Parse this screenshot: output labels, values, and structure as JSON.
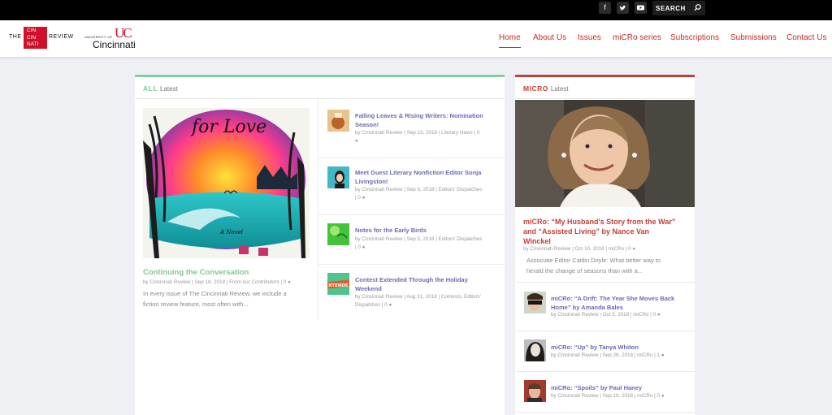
{
  "topbar": {
    "social": [
      "facebook-icon",
      "twitter-icon",
      "youtube-icon"
    ],
    "search_placeholder": "SEARCH"
  },
  "logo": {
    "the": "THE",
    "cin1": "CIN",
    "cin2": "CIN",
    "nati": "NATI",
    "review": "REVIEW",
    "uc_small": "UNIVERSITY OF",
    "uc_name": "Cincinnati"
  },
  "nav": [
    {
      "label": "Home"
    },
    {
      "label": "About Us"
    },
    {
      "label": "Issues"
    },
    {
      "label": "miCRo series"
    },
    {
      "label": "Subscriptions"
    },
    {
      "label": "Submissions"
    },
    {
      "label": "Contact Us"
    }
  ],
  "colors": {
    "accent_red": "#cc2b2b",
    "all_green": "#83d19f",
    "micro_red": "#c44036",
    "link_purple": "#6b6bb3"
  },
  "all": {
    "title": "ALL",
    "subtitle": "Latest",
    "feature": {
      "cover_text": "for Love",
      "cover_novel": "A Novel",
      "title": "Continuing the Conversation",
      "meta": "by Cincinnati Review | Sep 18, 2018 | From our Contributors | 0",
      "excerpt1": "In every issue of The Cincinnati Review, we include a",
      "excerpt2": "fiction review feature, most often with..."
    },
    "posts": [
      {
        "title1": "Falling Leaves & Rising Writers: Nomination",
        "title2": "Season!",
        "meta1": "by Cincinnati Review | Sep 13, 2018 | Literary News | 0",
        "meta2": ""
      },
      {
        "title1": "Meet Guest Literary Nonfiction Editor Sonja",
        "title2": "Livingston!",
        "meta1": "by Cincinnati Review | Sep 6, 2018 | Editors' Dispatches",
        "meta2": "| 0"
      },
      {
        "title1": "Notes for the Early Birds",
        "title2": "",
        "meta1": "by Cincinnati Review | Sep 5, 2018 | Editors' Dispatches",
        "meta2": "| 0"
      },
      {
        "title1": "Contest Extended Through the Holiday",
        "title2": "Weekend",
        "meta1": "by Cincinnati Review | Aug 31, 2018 | Contests, Editors'",
        "meta2": "Dispatches | 0"
      }
    ],
    "contest_thumb_text": "XTENDE"
  },
  "micro": {
    "title": "MICRO",
    "subtitle": "Latest",
    "feature": {
      "title1": "miCRo: “My Husband's Story from the War”",
      "title2": "and “Assisted Living” by Nance Van",
      "title3": "Winckel",
      "meta": "by Cincinnati Review | Oct 10, 2018 | miCRo | 0",
      "excerpt1": "Associate Editor Caitlin Doyle: What better way to",
      "excerpt2": "herald the change of seasons than with a..."
    },
    "posts": [
      {
        "title1": "miCRo: “A Drift: The Year She Moves Back",
        "title2": "Home” by Amanda Bales",
        "meta": "by Cincinnati Review | Oct 3, 2018 | miCRo | 0"
      },
      {
        "title1": "miCRo: “Up” by Tanya Whiton",
        "title2": "",
        "meta": "by Cincinnati Review | Sep 26, 2018 | miCRo | 1"
      },
      {
        "title1": "miCRo: “Spoils” by Paul Haney",
        "title2": "",
        "meta": "by Cincinnati Review | Sep 19, 2018 | miCRo | 0"
      }
    ]
  }
}
